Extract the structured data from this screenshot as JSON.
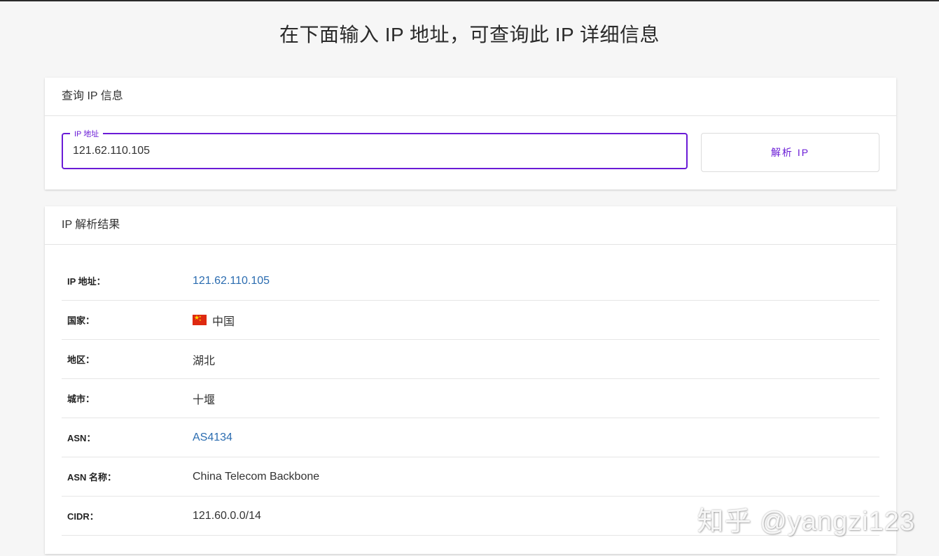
{
  "page": {
    "title": "在下面输入 IP 地址，可查询此 IP 详细信息"
  },
  "query": {
    "header": "查询 IP 信息",
    "field_label": "IP 地址",
    "field_value": "121.62.110.105",
    "button_label": "解析 IP",
    "accent_color": "#6a1bd6"
  },
  "result": {
    "header": "IP 解析结果",
    "rows": [
      {
        "label": "IP 地址：",
        "value": "121.62.110.105",
        "link": true
      },
      {
        "label": "国家：",
        "value": "中国",
        "icon": "china-flag-icon"
      },
      {
        "label": "地区：",
        "value": "湖北"
      },
      {
        "label": "城市：",
        "value": "十堰"
      },
      {
        "label": "ASN：",
        "value": "AS4134",
        "link": true
      },
      {
        "label": "ASN 名称：",
        "value": "China Telecom Backbone"
      },
      {
        "label": "CIDR：",
        "value": "121.60.0.0/14"
      }
    ]
  },
  "watermark": "知乎 @yangzi123"
}
